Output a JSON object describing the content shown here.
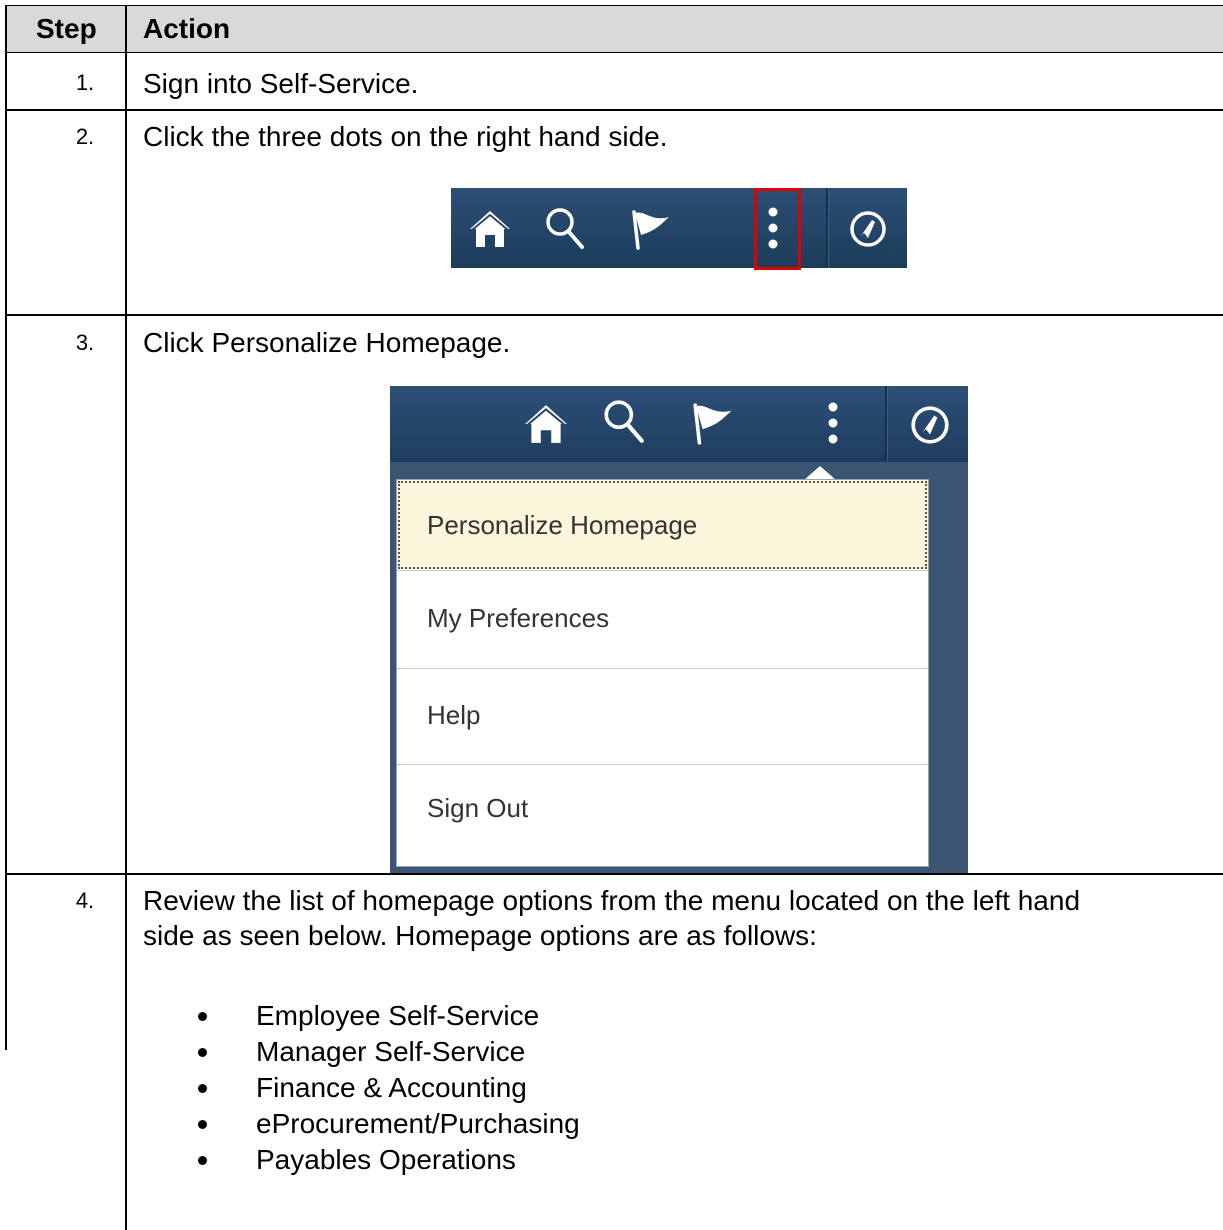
{
  "table": {
    "headers": {
      "step": "Step",
      "action": "Action"
    },
    "rows": [
      {
        "step": "1.",
        "action": "Sign into Self-Service."
      },
      {
        "step": "2.",
        "action": "Click the three dots on the right hand side."
      },
      {
        "step": "3.",
        "action": "Click Personalize Homepage."
      },
      {
        "step": "4.",
        "action_line1": "Review the list of homepage options from the menu located on the left hand",
        "action_line2": "side as seen below. Homepage options are as follows:",
        "options": [
          "Employee Self-Service",
          "Manager Self-Service",
          "Finance & Accounting",
          "eProcurement/Purchasing",
          "Payables Operations"
        ]
      }
    ]
  },
  "toolbar": {
    "icons": [
      "home-icon",
      "search-icon",
      "flag-icon",
      "actions-menu-icon",
      "navbar-compass-icon"
    ],
    "highlight_color": "#e00000"
  },
  "actions_menu": {
    "items": [
      "Personalize Homepage",
      "My Preferences",
      "Help",
      "Sign Out"
    ],
    "selected": "Personalize Homepage"
  }
}
